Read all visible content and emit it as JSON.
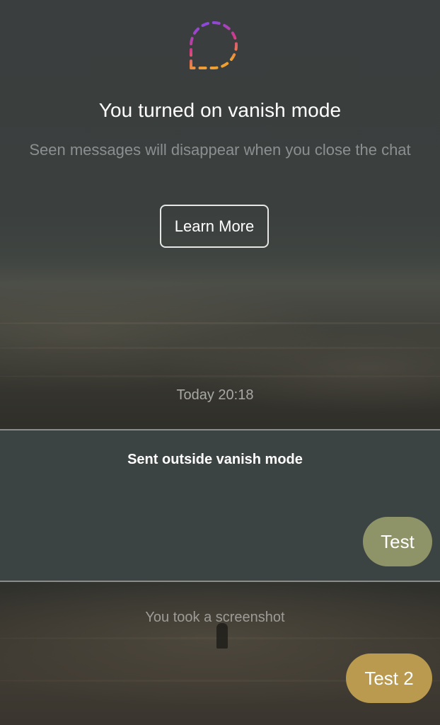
{
  "vanish_banner": {
    "icon": "vanish-mode-icon",
    "title": "You turned on vanish mode",
    "subtitle": "Seen messages will disappear when you close the chat",
    "learn_more_label": "Learn More"
  },
  "conversation": {
    "timestamp": "Today 20:18",
    "outside_section_label": "Sent outside vanish mode",
    "messages": [
      {
        "text": "Test",
        "sender": "me",
        "color": "#8f9468"
      },
      {
        "text": "Test 2",
        "sender": "me",
        "color": "#b99a4e"
      }
    ],
    "screenshot_notice": "You took a screenshot"
  },
  "colors": {
    "icon_gradient": [
      "#7b4cf0",
      "#d13a8a",
      "#f0a030"
    ],
    "panel_border": "#8a8d8c"
  }
}
